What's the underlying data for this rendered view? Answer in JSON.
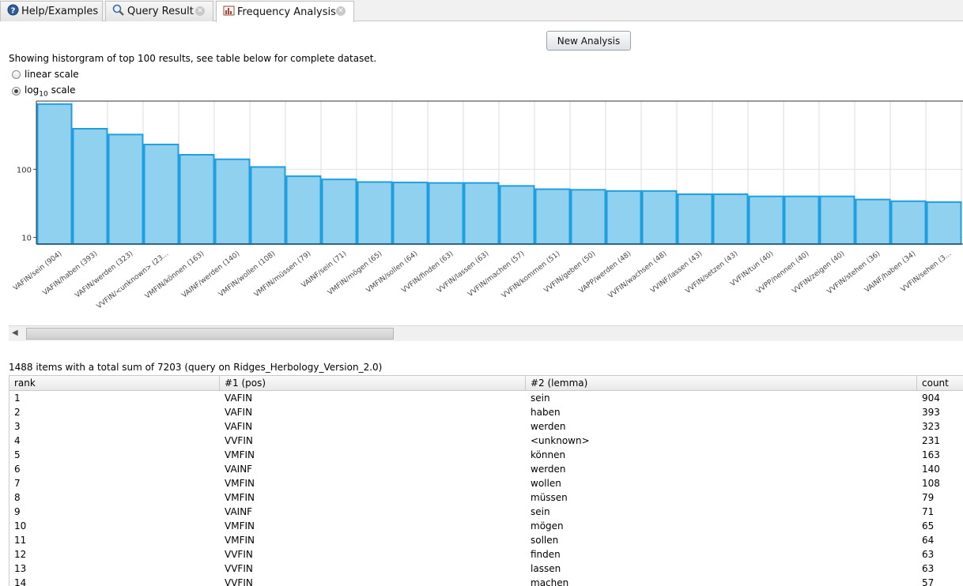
{
  "tabs": [
    {
      "label": "Help/Examples",
      "icon": "help-icon",
      "closable": false,
      "active": false
    },
    {
      "label": "Query Result",
      "icon": "magnifier-icon",
      "closable": true,
      "active": false
    },
    {
      "label": "Frequency Analysis",
      "icon": "frequency-icon",
      "closable": true,
      "active": true
    }
  ],
  "new_analysis_label": "New Analysis",
  "info_text": "Showing historgram of top 100 results, see table below for complete dataset.",
  "scale": {
    "linear_label": "linear scale",
    "log_label_prefix": "log",
    "log_label_sub": "10",
    "log_label_suffix": " scale",
    "selected": "log"
  },
  "chart_data": {
    "type": "bar",
    "yscale": "log",
    "yticks": [
      "10",
      "100"
    ],
    "bar_color": "#8fd1ee",
    "bar_border": "#1f9ee0",
    "categories": [
      "VAFIN/sein (904)",
      "VAFIN/haben (393)",
      "VAFIN/werden (323)",
      "VVFIN/<unknown> (23...",
      "VMFIN/können (163)",
      "VAINF/werden (140)",
      "VMFIN/wollen (108)",
      "VMFIN/müssen (79)",
      "VAINF/sein (71)",
      "VMFIN/mögen (65)",
      "VMFIN/sollen (64)",
      "VVFIN/finden (63)",
      "VVFIN/lassen (63)",
      "VVFIN/machen (57)",
      "VVFIN/kommen (51)",
      "VVFIN/geben (50)",
      "VAPP/werden (48)",
      "VVFIN/wachsen (48)",
      "VVINF/lassen (43)",
      "VVFIN/setzen (43)",
      "VVFIN/tun (40)",
      "VVPP/nennen (40)",
      "VVFIN/zeigen (40)",
      "VVFIN/stehen (36)",
      "VAINF/haben (34)",
      "VVFIN/sehen (3..."
    ],
    "values": [
      904,
      393,
      323,
      231,
      163,
      140,
      108,
      79,
      71,
      65,
      64,
      63,
      63,
      57,
      51,
      50,
      48,
      48,
      43,
      43,
      40,
      40,
      40,
      36,
      34,
      33
    ],
    "ylim": [
      8,
      1000
    ]
  },
  "summary": "1488 items with a total sum of 7203 (query on Ridges_Herbology_Version_2.0)",
  "table": {
    "columns": [
      "rank",
      "#1 (pos)",
      "#2 (lemma)",
      "count"
    ],
    "rows": [
      [
        "1",
        "VAFIN",
        "sein",
        "904"
      ],
      [
        "2",
        "VAFIN",
        "haben",
        "393"
      ],
      [
        "3",
        "VAFIN",
        "werden",
        "323"
      ],
      [
        "4",
        "VVFIN",
        "<unknown>",
        "231"
      ],
      [
        "5",
        "VMFIN",
        "können",
        "163"
      ],
      [
        "6",
        "VAINF",
        "werden",
        "140"
      ],
      [
        "7",
        "VMFIN",
        "wollen",
        "108"
      ],
      [
        "8",
        "VMFIN",
        "müssen",
        "79"
      ],
      [
        "9",
        "VAINF",
        "sein",
        "71"
      ],
      [
        "10",
        "VMFIN",
        "mögen",
        "65"
      ],
      [
        "11",
        "VMFIN",
        "sollen",
        "64"
      ],
      [
        "12",
        "VVFIN",
        "finden",
        "63"
      ],
      [
        "13",
        "VVFIN",
        "lassen",
        "63"
      ],
      [
        "14",
        "VVFIN",
        "machen",
        "57"
      ]
    ]
  }
}
